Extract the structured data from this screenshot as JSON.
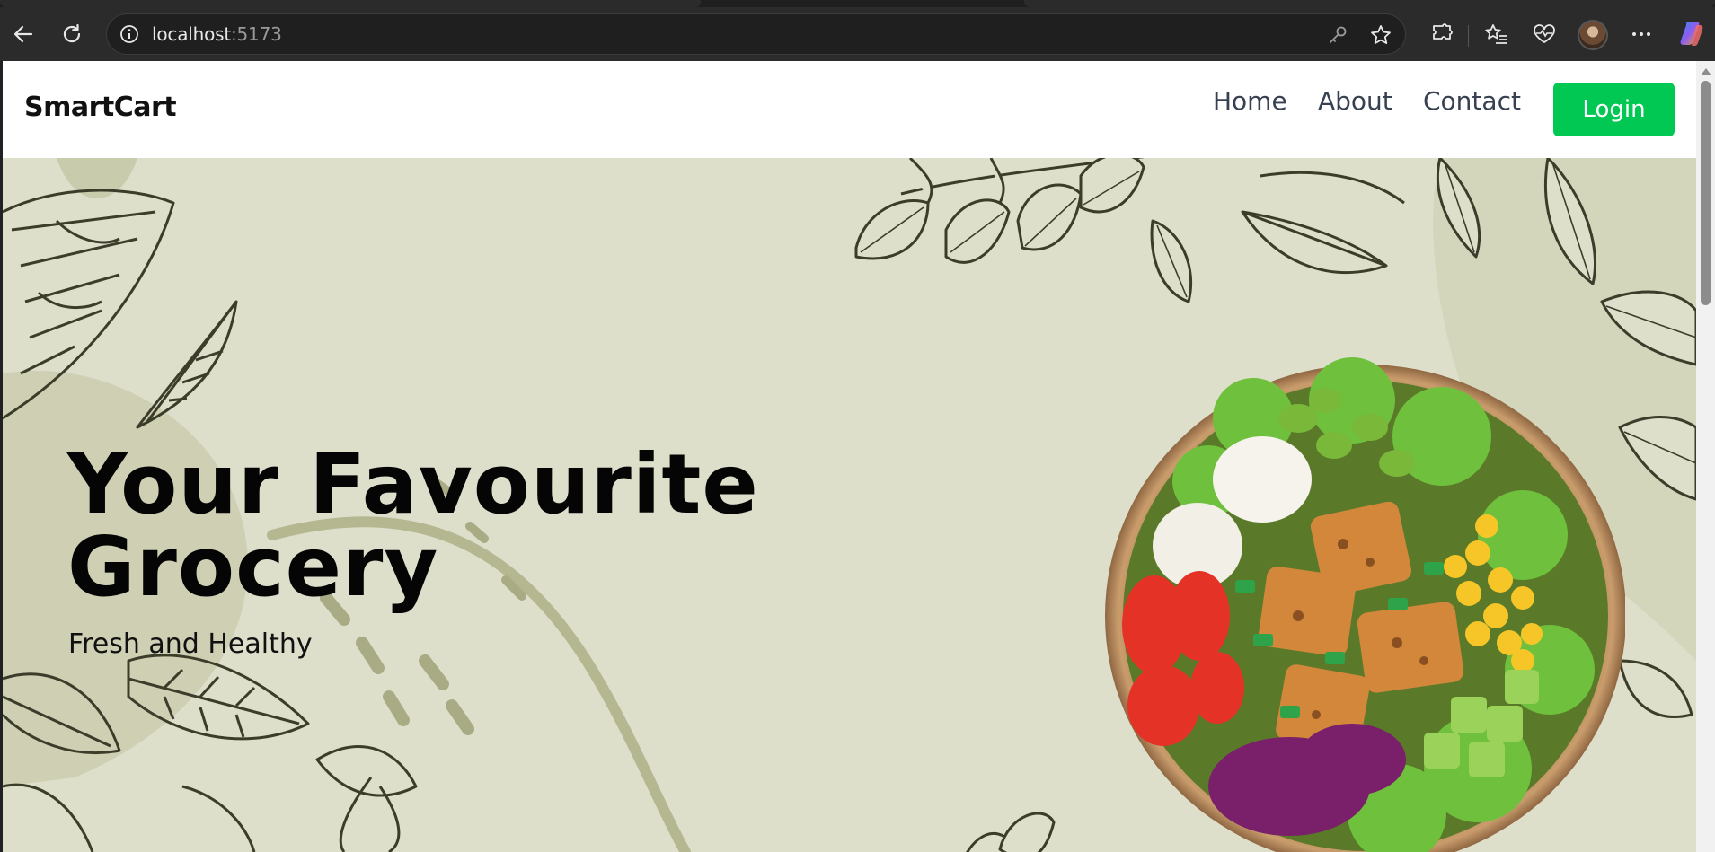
{
  "browser": {
    "address": {
      "host": "localhost",
      "port": ":5173"
    },
    "icons": {
      "back": "back-arrow-icon",
      "reload": "reload-icon",
      "site_info": "info-icon",
      "password": "key-icon",
      "favorite": "star-icon",
      "extensions": "puzzle-icon",
      "favorites": "favorites-list-icon",
      "health": "heartbeat-icon",
      "profile": "avatar",
      "menu": "more-icon",
      "copilot": "copilot-icon"
    }
  },
  "site": {
    "brand": "SmartCart",
    "nav": [
      {
        "label": "Home"
      },
      {
        "label": "About"
      },
      {
        "label": "Contact"
      }
    ],
    "login_label": "Login",
    "colors": {
      "accent": "#00c853",
      "hero_bg": "#dedfcb",
      "leaf_stroke": "#3b3d2a"
    }
  },
  "hero": {
    "title_line1": "Your Favourite",
    "title_line2": "Grocery",
    "subtitle": "Fresh and Healthy",
    "image": "salad-bowl-image"
  }
}
